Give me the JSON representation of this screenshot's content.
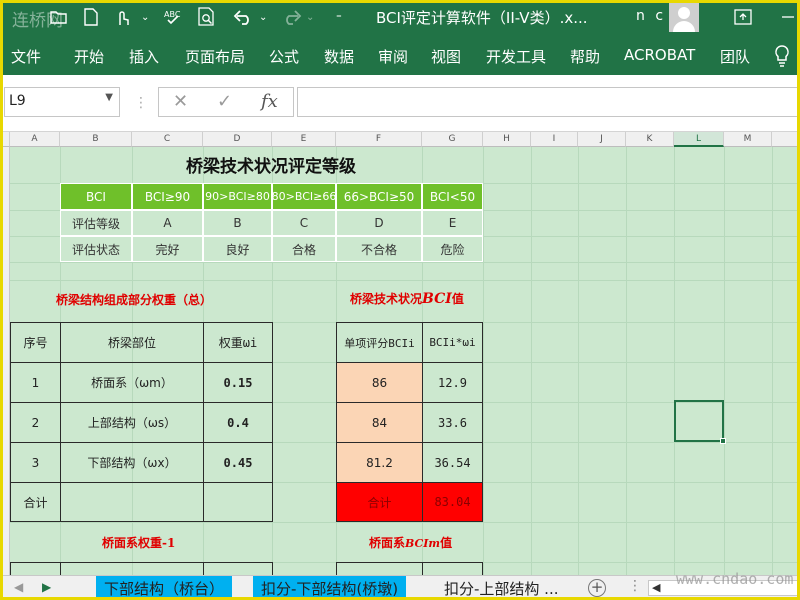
{
  "window": {
    "title": "BCI评定计算软件（II-V类）.x...",
    "user": "n c",
    "watermark_top": "连桥网",
    "watermark_bottom": "www.cndao.com"
  },
  "ribbon": {
    "tabs": [
      "文件",
      "开始",
      "插入",
      "页面布局",
      "公式",
      "数据",
      "审阅",
      "视图",
      "开发工具",
      "帮助",
      "ACROBAT",
      "团队"
    ]
  },
  "formula_bar": {
    "name_box": "L9",
    "cancel": "✕",
    "enter": "✓",
    "fx": "fx",
    "value": ""
  },
  "grid": {
    "columns": [
      "A",
      "B",
      "C",
      "D",
      "E",
      "F",
      "G",
      "H",
      "I",
      "J",
      "K",
      "L",
      "M"
    ],
    "selected_column": "L"
  },
  "sheet": {
    "main_title": "桥梁技术状况评定等级",
    "grade_table": {
      "header": [
        "BCI",
        "BCI≥90",
        "90>BCI≥80",
        "80>BCI≥66",
        "66>BCI≥50",
        "BCI<50"
      ],
      "rows": [
        [
          "评估等级",
          "A",
          "B",
          "C",
          "D",
          "E"
        ],
        [
          "评估状态",
          "完好",
          "良好",
          "合格",
          "不合格",
          "危险"
        ]
      ]
    },
    "weight_title": "桥梁结构组成部分权重（总）",
    "bci_title_prefix": "桥梁技术状况",
    "bci_title_suffix": "值",
    "bci_title_var": "BCI",
    "weight_table": {
      "header": [
        "序号",
        "桥梁部位",
        "权重ωi"
      ],
      "rows": [
        [
          "1",
          "桥面系（ωm）",
          "0.15"
        ],
        [
          "2",
          "上部结构（ωs）",
          "0.4"
        ],
        [
          "3",
          "下部结构（ωx）",
          "0.45"
        ]
      ],
      "total": "合计"
    },
    "bci_table": {
      "header": [
        "单项评分BCIi",
        "BCIi*ωi"
      ],
      "rows": [
        [
          "86",
          "12.9"
        ],
        [
          "84",
          "33.6"
        ],
        [
          "81.2",
          "36.54"
        ]
      ],
      "total_label": "合计",
      "total_value": "83.04"
    },
    "deck_weight_title": "桥面系权重-1",
    "deck_bci_title_prefix": "桥面系",
    "deck_bci_title_var": "BCIm",
    "deck_bci_title_suffix": "值"
  },
  "sheet_tabs": {
    "tabs": [
      "下部结构（桥台）",
      "扣分-下部结构(桥墩)",
      "扣分-上部结构 ..."
    ],
    "add_label": "+"
  },
  "colors": {
    "excel_green": "#217346",
    "header_green": "#6fc02a",
    "grid_bg": "#cce8cf",
    "peach": "#fbd5b5",
    "red": "#ff0000",
    "tab_blue": "#00b0f0"
  }
}
